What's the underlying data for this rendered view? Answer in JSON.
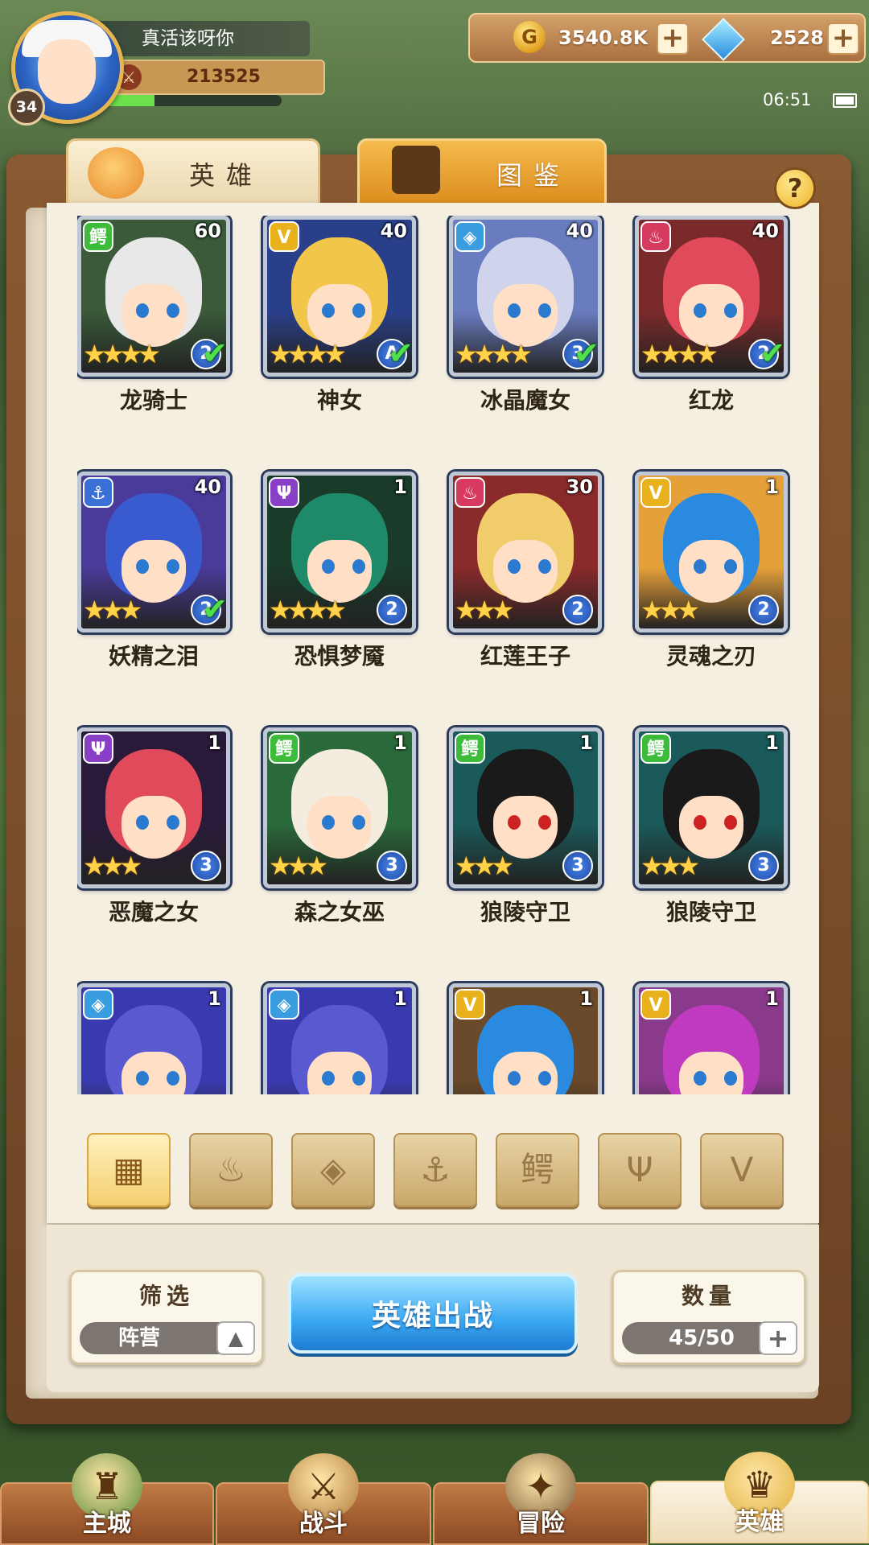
{
  "player": {
    "name": "真活该呀你",
    "level": "34",
    "power": "213525",
    "exp_fraction": 0.28
  },
  "resources": {
    "gold": "3540.8K",
    "gems": "2528",
    "gold_icon": "gold-coin-icon",
    "gem_icon": "diamond-icon"
  },
  "status": {
    "time": "06:51"
  },
  "tabs": [
    {
      "label": "英雄",
      "icon": "knight-helmet-icon",
      "active": true
    },
    {
      "label": "图鉴",
      "icon": "magnifier-icon",
      "active": false
    }
  ],
  "heroes": [
    {
      "name": "龙骑士",
      "level": "60",
      "faction": "beast",
      "stars": 4,
      "rank": "2",
      "checked": true
    },
    {
      "name": "神女",
      "level": "40",
      "faction": "light",
      "stars": 4,
      "rank": "A",
      "checked": true
    },
    {
      "name": "冰晶魔女",
      "level": "40",
      "faction": "water",
      "stars": 4,
      "rank": "3",
      "checked": true
    },
    {
      "name": "红龙",
      "level": "40",
      "faction": "fire",
      "stars": 4,
      "rank": "2",
      "checked": true
    },
    {
      "name": "妖精之泪",
      "level": "40",
      "faction": "anchor",
      "stars": 3,
      "rank": "2",
      "checked": true
    },
    {
      "name": "恐惧梦魇",
      "level": "1",
      "faction": "dark",
      "stars": 4,
      "rank": "2",
      "checked": false
    },
    {
      "name": "红莲王子",
      "level": "30",
      "faction": "fire",
      "stars": 3,
      "rank": "2",
      "checked": false
    },
    {
      "name": "灵魂之刃",
      "level": "1",
      "faction": "light",
      "stars": 3,
      "rank": "2",
      "checked": false
    },
    {
      "name": "恶魔之女",
      "level": "1",
      "faction": "dark",
      "stars": 3,
      "rank": "3",
      "checked": false
    },
    {
      "name": "森之女巫",
      "level": "1",
      "faction": "beast",
      "stars": 3,
      "rank": "3",
      "checked": false
    },
    {
      "name": "狼陵守卫",
      "level": "1",
      "faction": "beast",
      "stars": 3,
      "rank": "3",
      "checked": false
    },
    {
      "name": "狼陵守卫",
      "level": "1",
      "faction": "beast",
      "stars": 3,
      "rank": "3",
      "checked": false
    },
    {
      "name": "",
      "level": "1",
      "faction": "water",
      "stars": 0,
      "rank": "",
      "checked": false
    },
    {
      "name": "",
      "level": "1",
      "faction": "water",
      "stars": 0,
      "rank": "",
      "checked": false
    },
    {
      "name": "",
      "level": "1",
      "faction": "light",
      "stars": 0,
      "rank": "",
      "checked": false
    },
    {
      "name": "",
      "level": "1",
      "faction": "light",
      "stars": 0,
      "rank": "",
      "checked": false
    }
  ],
  "faction_colors": {
    "beast": "#3dbb3a",
    "light": "#e9b21c",
    "water": "#3a9de0",
    "fire": "#d63a5e",
    "anchor": "#3a6fd6",
    "dark": "#8a3fc7"
  },
  "filter_icons": [
    {
      "icon": "grid-all-icon",
      "active": true
    },
    {
      "icon": "fire-faction-icon",
      "active": false
    },
    {
      "icon": "water-faction-icon",
      "active": false
    },
    {
      "icon": "anchor-faction-icon",
      "active": false
    },
    {
      "icon": "beast-faction-icon",
      "active": false
    },
    {
      "icon": "dark-faction-icon",
      "active": false
    },
    {
      "icon": "light-faction-icon",
      "active": false
    }
  ],
  "filter": {
    "title": "筛选",
    "value": "阵营"
  },
  "deploy_button": "英雄出战",
  "count": {
    "title": "数量",
    "value": "45/50"
  },
  "nav": [
    {
      "label": "主城",
      "icon": "castle-icon",
      "active": false
    },
    {
      "label": "战斗",
      "icon": "crossed-swords-icon",
      "active": false
    },
    {
      "label": "冒险",
      "icon": "map-scroll-icon",
      "active": false
    },
    {
      "label": "英雄",
      "icon": "hero-crest-icon",
      "active": true
    }
  ]
}
